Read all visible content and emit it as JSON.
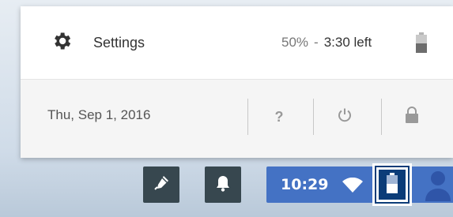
{
  "menu": {
    "settings_label": "Settings",
    "battery_percent": "50%",
    "separator": "-",
    "battery_time_left": "3:30 left",
    "date": "Thu, Sep 1, 2016",
    "help_label": "?"
  },
  "shelf": {
    "clock": "10:29",
    "battery_level": 0.5
  },
  "colors": {
    "popup_bg": "#ffffff",
    "popup_footer_bg": "#f5f5f5",
    "shelf_button_bg": "#37474f",
    "tray_bg": "#4472c4",
    "highlight_border": "#0b3c78",
    "icon_gray": "#999999"
  },
  "icons": {
    "settings": "gear-icon",
    "battery": "battery-icon",
    "help": "help-icon",
    "power": "power-icon",
    "lock": "lock-icon",
    "stylus": "stylus-icon",
    "notifications": "bell-icon",
    "wifi": "wifi-icon",
    "user": "user-avatar-icon"
  }
}
